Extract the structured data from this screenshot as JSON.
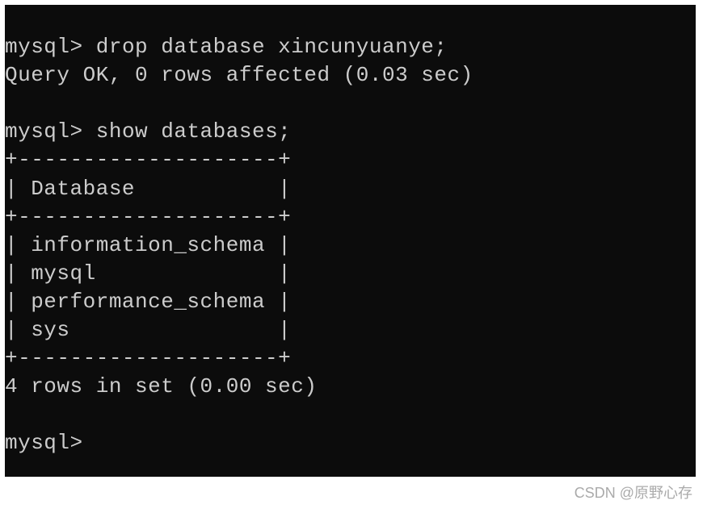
{
  "terminal": {
    "prompt": "mysql>",
    "cmd1": "drop database xincunyuanye;",
    "result1": "Query OK, 0 rows affected (0.03 sec)",
    "cmd2": "show databases;",
    "tableBorder": "+--------------------+",
    "tableHeader": "| Database           |",
    "tableRow1": "| information_schema |",
    "tableRow2": "| mysql              |",
    "tableRow3": "| performance_schema |",
    "tableRow4": "| sys                |",
    "result2": "4 rows in set (0.00 sec)",
    "emptyPrompt": "mysql>"
  },
  "watermark": "CSDN @原野心存"
}
